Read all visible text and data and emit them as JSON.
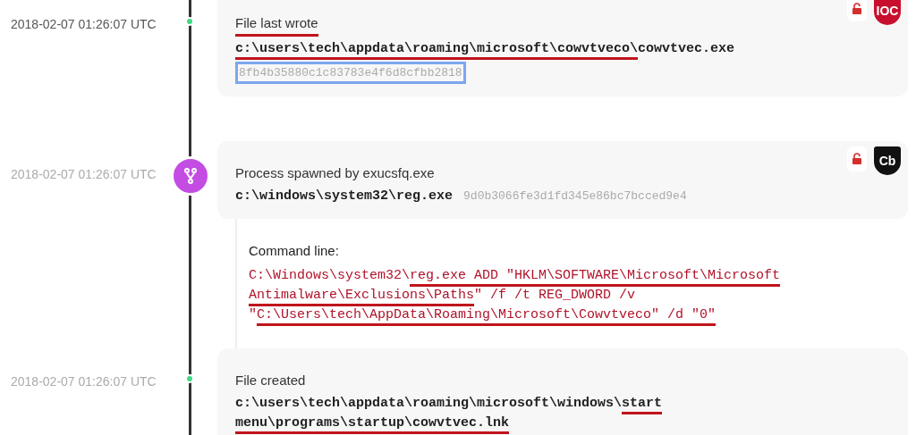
{
  "events": [
    {
      "kind": "file",
      "timestamp": "2018-02-07 01:26:07 UTC",
      "timestamp_dim": false,
      "title": "File last wrote",
      "title_marked": true,
      "path": [
        [
          {
            "text": "c:\\users\\tech\\appdata\\roaming\\microsoft\\cowvtveco\\",
            "marked": true
          },
          {
            "text": "cowvtvec.exe",
            "marked": false
          }
        ]
      ],
      "hash": "8fb4b35880c1c83783e4f6d8cfbb2818",
      "hash_boxed": true,
      "lock": true,
      "badge": {
        "text": "IOC",
        "color": "#c8102e"
      }
    },
    {
      "kind": "process",
      "timestamp": "2018-02-07 01:26:07 UTC",
      "timestamp_dim": true,
      "title": "Process spawned by exucsfq.exe",
      "title_marked": false,
      "path": [
        [
          {
            "text": "c:\\windows\\system32\\reg.exe",
            "marked": false
          }
        ]
      ],
      "hash": "9d0b3066fe3d1fd345e86bc7bcced9e4",
      "hash_boxed": false,
      "lock": true,
      "badge": {
        "text": "Cb",
        "color": "#111111"
      },
      "detail_label": "Command line:",
      "command": [
        [
          {
            "text": "C:\\Windows\\system32\\",
            "marked": false
          },
          {
            "text": "reg.exe ADD \"HKLM\\SOFTWARE\\Microsoft\\Microsoft",
            "marked": true
          }
        ],
        [
          {
            "text": "Antimalware\\Exclusions\\Paths",
            "marked": true
          },
          {
            "text": "\" /f /t REG_DWORD /v",
            "marked": false
          }
        ],
        [
          {
            "text": "\"",
            "marked": false
          },
          {
            "text": "C:\\Users\\tech\\AppData\\Roaming\\Microsoft\\Cowvtveco\" /d \"0\"",
            "marked": true
          }
        ]
      ]
    },
    {
      "kind": "file",
      "timestamp": "2018-02-07 01:26:07 UTC",
      "timestamp_dim": true,
      "title": "File created",
      "title_marked": false,
      "lock": false,
      "path": [
        [
          {
            "text": "c:\\users\\tech\\appdata\\roaming\\microsoft\\windows\\",
            "marked": false
          },
          {
            "text": "start",
            "marked": true
          }
        ],
        [
          {
            "text": "menu\\programs\\startup\\cowvtvec.lnk",
            "marked": true
          }
        ]
      ]
    }
  ]
}
